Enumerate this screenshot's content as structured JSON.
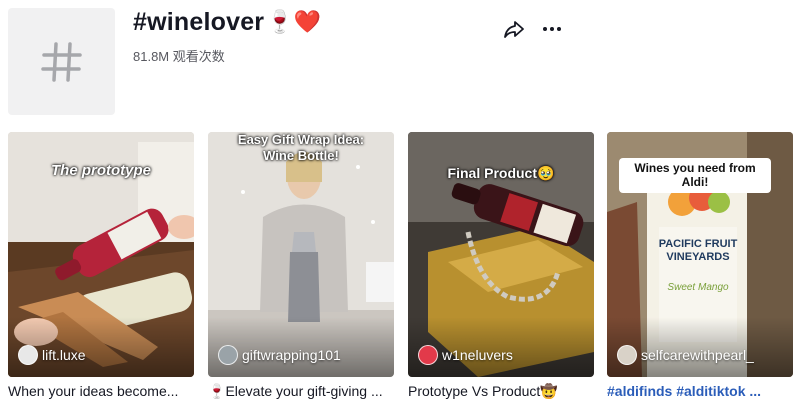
{
  "header": {
    "title": "#winelover",
    "title_emojis": "🍷❤️",
    "views": "81.8M 观看次数",
    "icons": [
      "hashtag-icon",
      "share-icon",
      "more-icon"
    ]
  },
  "videos": [
    {
      "author": "lift.luxe",
      "caption_in_video": "The prototype",
      "description": "When your ideas become..."
    },
    {
      "author": "giftwrapping101",
      "caption_in_video": "Easy Gift Wrap Idea: Wine Bottle!",
      "description_emoji": "🍷",
      "description": "Elevate your gift-giving ..."
    },
    {
      "author": "w1neluvers",
      "caption_in_video": "Final Product🥹",
      "description": "Prototype Vs Product",
      "description_emoji": "🤠"
    },
    {
      "author": "selfcarewithpearl_",
      "caption_in_video": "Wines you need from Aldi!",
      "description": "#aldifinds #alditiktok ...",
      "label_on_bottle": "PACIFIC FRUIT VINEYARDS",
      "bottle_sub": "Sweet Mango"
    }
  ],
  "colors": {
    "text": "#161823",
    "muted": "#57585f",
    "hashtag_link": "#2b5db9",
    "avatar_bg": "#f1f1f2"
  }
}
